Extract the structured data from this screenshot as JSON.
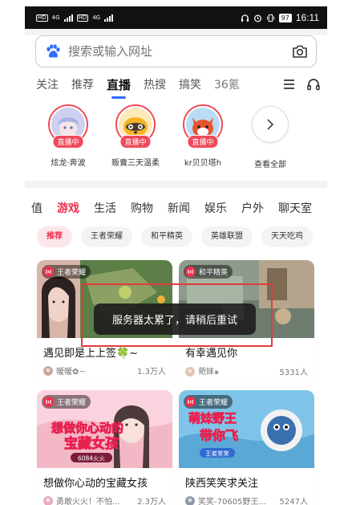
{
  "status_bar": {
    "left_tags": [
      "HD",
      "HD"
    ],
    "signal_labels": [
      "4G",
      "4G"
    ],
    "battery": "97",
    "time": "16:11"
  },
  "search": {
    "placeholder": "搜索或输入网址"
  },
  "tabs": [
    {
      "label": "关注",
      "active": false
    },
    {
      "label": "推荐",
      "active": false
    },
    {
      "label": "直播",
      "active": true
    },
    {
      "label": "热搜",
      "active": false
    },
    {
      "label": "搞笑",
      "active": false
    },
    {
      "label": "36氪",
      "active": false
    }
  ],
  "streamers": [
    {
      "name": "炫龙·奔波",
      "badge": "直播中"
    },
    {
      "name": "贩賣三天温柔",
      "badge": "直播中"
    },
    {
      "name": "kr贝贝塔h",
      "badge": "直播中"
    }
  ],
  "see_all": {
    "label": "查看全部"
  },
  "categories": [
    {
      "label": "值",
      "active": false
    },
    {
      "label": "游戏",
      "active": true
    },
    {
      "label": "生活",
      "active": false
    },
    {
      "label": "购物",
      "active": false
    },
    {
      "label": "新闻",
      "active": false
    },
    {
      "label": "娱乐",
      "active": false
    },
    {
      "label": "户外",
      "active": false
    },
    {
      "label": "聊天室",
      "active": false
    }
  ],
  "chips": [
    {
      "label": "推荐",
      "active": true
    },
    {
      "label": "王者荣耀",
      "active": false
    },
    {
      "label": "和平精英",
      "active": false
    },
    {
      "label": "英雄联盟",
      "active": false
    },
    {
      "label": "天天吃鸡",
      "active": false
    }
  ],
  "cards": [
    {
      "game": "王者荣耀",
      "title": "遇见即是上上签🍀~",
      "uploader": "暖暖✿~",
      "viewers": "1.3万人"
    },
    {
      "game": "和平精英",
      "title": "有幸遇见你",
      "uploader": "菀妹๑",
      "viewers": "5331人"
    },
    {
      "game": "王者荣耀",
      "title": "想做你心动的宝藏女孩",
      "uploader": "勇敢火火！不怕...",
      "viewers": "2.3万人"
    },
    {
      "game": "王者荣耀",
      "title": "陕西笑笑求关注",
      "uploader": "笑笑-70605野王...",
      "viewers": "5247人"
    }
  ],
  "thumb_text": {
    "card3_line1": "想做你心动的",
    "card3_line2": "宝藏女孩",
    "card3_tag": "6084火火",
    "card4_line1": "萌妹野王",
    "card4_line2": "带你飞",
    "card4_tag": "王者笑笑"
  },
  "toast": {
    "message": "服务器太累了，请稍后重试"
  },
  "colors": {
    "accent_red": "#f0304c",
    "live_red": "#f04a5a",
    "tab_indicator": "#2f6bff"
  }
}
